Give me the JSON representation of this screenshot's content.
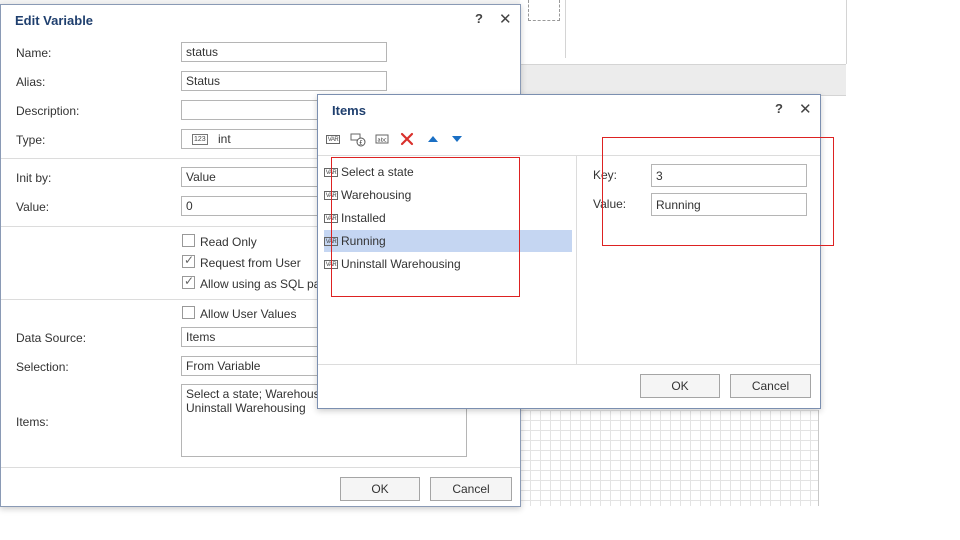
{
  "edit_variable": {
    "title": "Edit Variable",
    "help": "?",
    "close": "✕",
    "name_label": "Name:",
    "name_value": "status",
    "alias_label": "Alias:",
    "alias_value": "Status",
    "description_label": "Description:",
    "description_value": "",
    "type_label": "Type:",
    "type_value": "int",
    "init_by_label": "Init by:",
    "init_by_value": "Value",
    "value_label": "Value:",
    "value_value": "0",
    "read_only_label": "Read Only",
    "request_from_user_label": "Request from User",
    "allow_sql_label": "Allow using as SQL pa",
    "allow_user_values_label": "Allow User Values",
    "data_source_label": "Data Source:",
    "data_source_value": "Items",
    "selection_label": "Selection:",
    "selection_value": "From Variable",
    "items_label": "Items:",
    "items_line1": "Select a state; Warehous",
    "items_line2": "Uninstall Warehousing",
    "ok": "OK",
    "cancel": "Cancel"
  },
  "items_dialog": {
    "title": "Items",
    "help": "?",
    "close": "✕",
    "list": [
      {
        "label": "Select a state"
      },
      {
        "label": "Warehousing"
      },
      {
        "label": "Installed"
      },
      {
        "label": "Running"
      },
      {
        "label": "Uninstall Warehousing"
      }
    ],
    "key_label": "Key:",
    "key_value": "3",
    "value_label": "Value:",
    "value_value": "Running",
    "ok": "OK",
    "cancel": "Cancel"
  },
  "colors": {
    "title": "#1f3f6e",
    "selection": "#c5d6f2",
    "highlight_box": "#dd2222",
    "toolbar_blue": "#1a6fc4",
    "toolbar_red": "#d9302c"
  }
}
